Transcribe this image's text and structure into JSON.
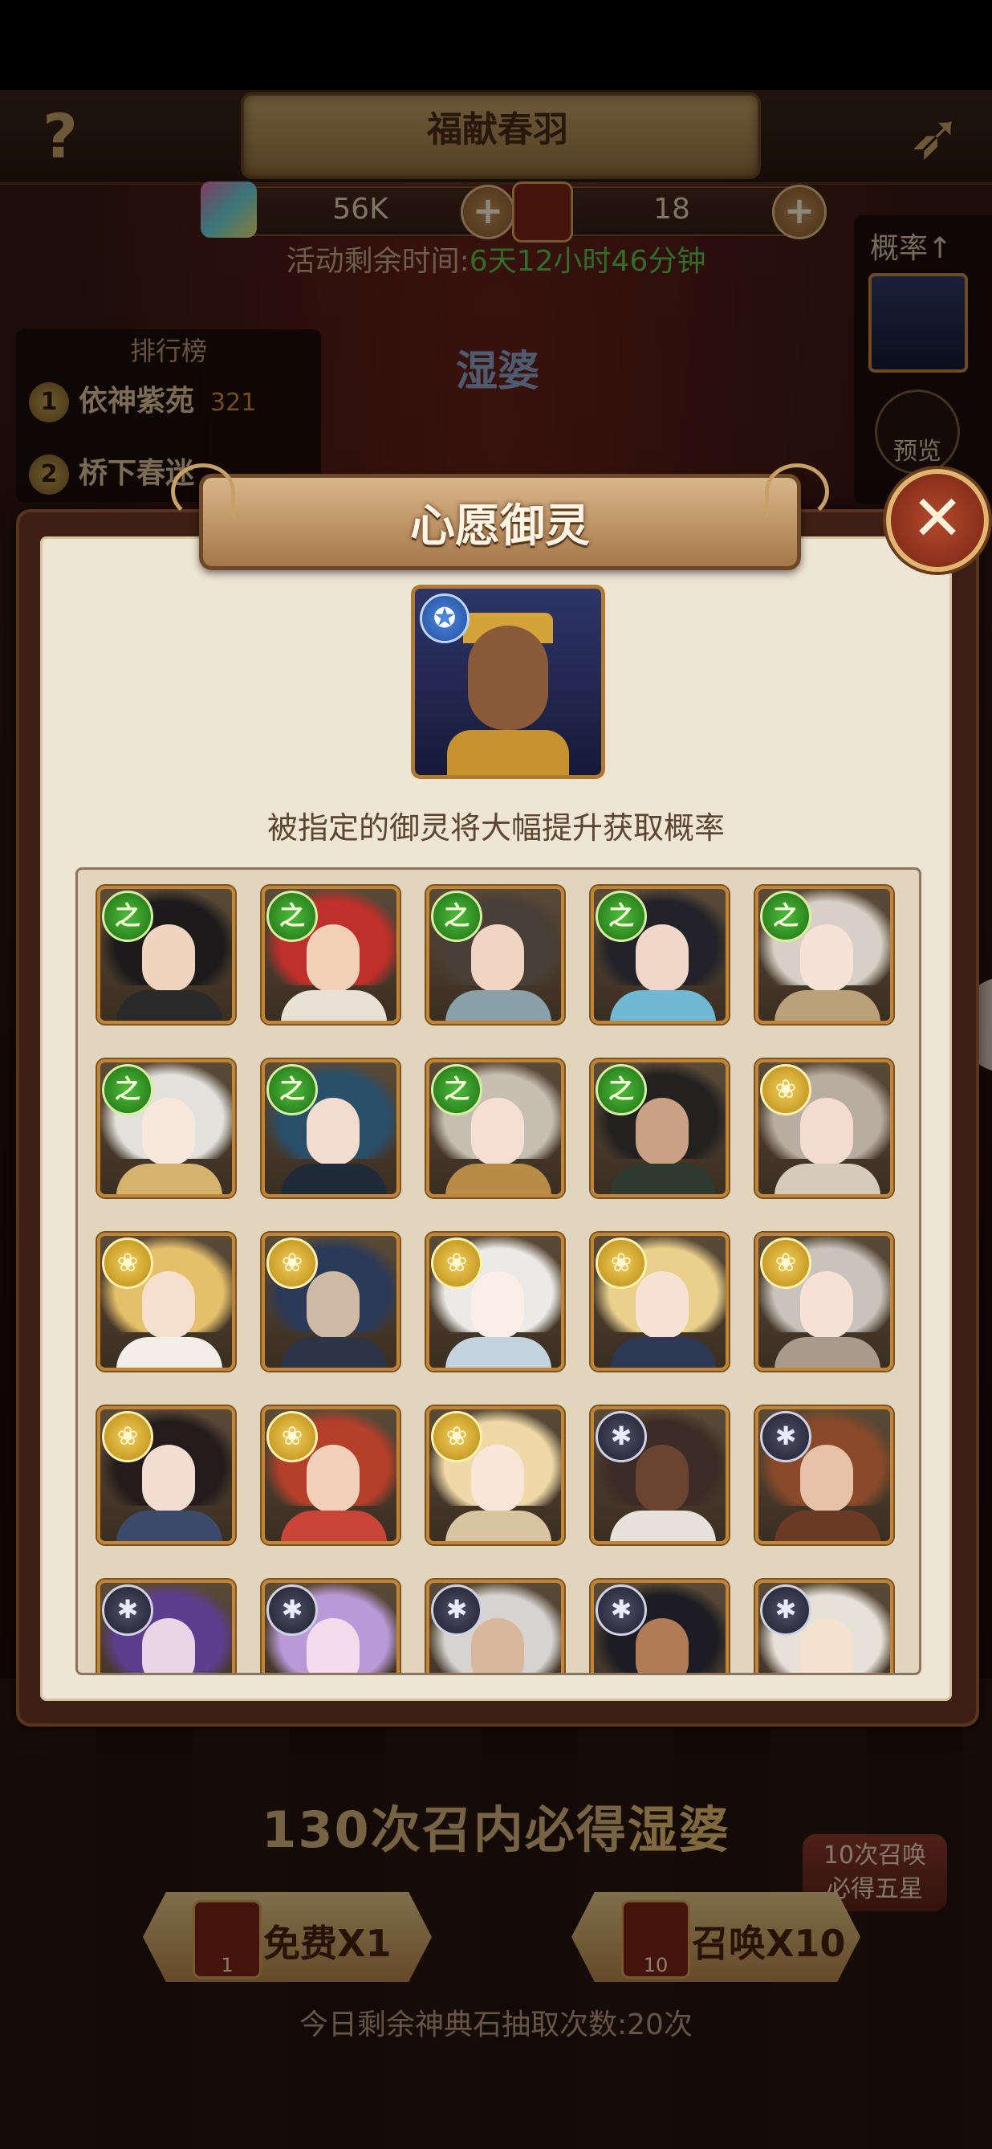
{
  "header": {
    "title": "福献春羽",
    "help_glyph": "?",
    "back_glyph": "➶"
  },
  "currencies": [
    {
      "value": "56K",
      "icon": "gem-icon",
      "plus": "+"
    },
    {
      "value": "18",
      "icon": "blessing-ticket-icon",
      "plus": "+"
    }
  ],
  "timer": {
    "label": "活动剩余时间:",
    "value": "6天12小时46分钟"
  },
  "ranking": {
    "title": "排行榜",
    "rows": [
      {
        "rank": "1",
        "name": "依神紫苑",
        "score": "321"
      },
      {
        "rank": "2",
        "name": "桥下春迷",
        "score": ""
      }
    ]
  },
  "featured_name": "湿婆",
  "rate": {
    "label": "概率↑",
    "preview_label": "预览"
  },
  "dialog": {
    "title": "心愿御灵",
    "close_glyph": "✕",
    "hint": "被指定的御灵将大幅提升获取概率",
    "selected_badge": "✪"
  },
  "rank_glyphs": {
    "green": "之",
    "gold": "❀",
    "dark": "✱"
  },
  "colors": {
    "accent_gold": "#c28533",
    "timer_green": "#59c64b",
    "dialog_bg": "#efe5d3",
    "rank_green": "#4dbd3b",
    "rank_gold": "#f1cf5a",
    "rank_dark": "#20202e"
  },
  "grid": [
    {
      "rank": "green",
      "hair": "#1c1a1a",
      "skin": "#efd4bf",
      "cloth": "#2a2a2a"
    },
    {
      "rank": "green",
      "hair": "#c0302a",
      "skin": "#f1d0b6",
      "cloth": "#e9e0d6"
    },
    {
      "rank": "green",
      "hair": "#4a3f36",
      "skin": "#efd5c2",
      "cloth": "#8aa0a8"
    },
    {
      "rank": "green",
      "hair": "#222228",
      "skin": "#f0d7c7",
      "cloth": "#6fb8d6"
    },
    {
      "rank": "green",
      "hair": "#d8d0c6",
      "skin": "#f6e3d8",
      "cloth": "#b9a27a"
    },
    {
      "rank": "green",
      "hair": "#e3e1dc",
      "skin": "#f8e7dd",
      "cloth": "#d6b36d"
    },
    {
      "rank": "green",
      "hair": "#2a4f6a",
      "skin": "#f1dccd",
      "cloth": "#1f2b38"
    },
    {
      "rank": "green",
      "hair": "#c8bfb3",
      "skin": "#f4dfd2",
      "cloth": "#b88c46"
    },
    {
      "rank": "green",
      "hair": "#232020",
      "skin": "#c9a184",
      "cloth": "#2f3b30"
    },
    {
      "rank": "gold",
      "hair": "#b8ada0",
      "skin": "#f3dccd",
      "cloth": "#d6cbb9"
    },
    {
      "rank": "gold",
      "hair": "#e5c06b",
      "skin": "#f6dfcf",
      "cloth": "#f3efe8"
    },
    {
      "rank": "gold",
      "hair": "#2a3a58",
      "skin": "#cfb9a5",
      "cloth": "#2c3548"
    },
    {
      "rank": "gold",
      "hair": "#eceae6",
      "skin": "#faeee6",
      "cloth": "#c3d2df"
    },
    {
      "rank": "gold",
      "hair": "#e9d18c",
      "skin": "#f7e2d4",
      "cloth": "#2d3954"
    },
    {
      "rank": "gold",
      "hair": "#c9c3bc",
      "skin": "#f6e1d7",
      "cloth": "#a89b8c"
    },
    {
      "rank": "gold",
      "hair": "#241c1c",
      "skin": "#f3ddd0",
      "cloth": "#3b4a6a"
    },
    {
      "rank": "gold",
      "hair": "#b5402a",
      "skin": "#f2cfb8",
      "cloth": "#c9453a"
    },
    {
      "rank": "gold",
      "hair": "#efd9a8",
      "skin": "#f8e6d8",
      "cloth": "#d8c4a0"
    },
    {
      "rank": "dark",
      "hair": "#3c2c25",
      "skin": "#6b4331",
      "cloth": "#e6e1da"
    },
    {
      "rank": "dark",
      "hair": "#8a4a2a",
      "skin": "#e8c2a6",
      "cloth": "#6a3a24"
    },
    {
      "rank": "dark",
      "hair": "#5b3f8e",
      "skin": "#e9d3e6",
      "cloth": "#3e2a5a"
    },
    {
      "rank": "dark",
      "hair": "#b89ad8",
      "skin": "#f2dcec",
      "cloth": "#7a5aa0"
    },
    {
      "rank": "dark",
      "hair": "#d6d3d0",
      "skin": "#d9b79b",
      "cloth": "#2a2a2a"
    },
    {
      "rank": "dark",
      "hair": "#1c1c22",
      "skin": "#b07a55",
      "cloth": "#c98f2f"
    },
    {
      "rank": "dark",
      "hair": "#e7e2d8",
      "skin": "#f4e1cf",
      "cloth": "#8a6040"
    }
  ],
  "bottom": {
    "guarantee_prefix": "130次召内必得",
    "guarantee_name": "湿婆",
    "ten_badge_line1": "10次召唤",
    "ten_badge_line2": "必得五星",
    "free_label": "免费X1",
    "free_count": "1",
    "summon_label": "召唤X10",
    "summon_count": "10",
    "draws_left": "今日剩余神典石抽取次数:20次"
  }
}
